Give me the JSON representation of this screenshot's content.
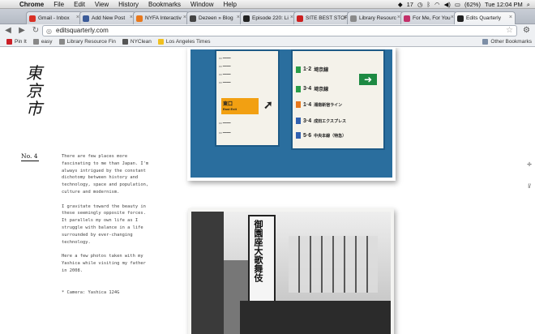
{
  "menubar": {
    "app": "Chrome",
    "items": [
      "File",
      "Edit",
      "View",
      "History",
      "Bookmarks",
      "Window",
      "Help"
    ],
    "status": {
      "notifications": "17",
      "battery": "(62%)",
      "clock": "Tue 12:04 PM"
    }
  },
  "tabs": [
    {
      "label": "Gmail - Inbox",
      "color": "#d93025"
    },
    {
      "label": "Add New Post",
      "color": "#3b5b99"
    },
    {
      "label": "NYFA Interactiv",
      "color": "#e8781c"
    },
    {
      "label": "Dezeen » Blog",
      "color": "#444444"
    },
    {
      "label": "Episode 220: Li",
      "color": "#222222"
    },
    {
      "label": "SITE BEST STOR",
      "color": "#cc1f1f"
    },
    {
      "label": "Library Resourc",
      "color": "#8a8a8a"
    },
    {
      "label": "For Me, For You",
      "color": "#c3306a"
    },
    {
      "label": "Edits Quarterly",
      "color": "#222222"
    }
  ],
  "toolbar": {
    "url": "editsquarterly.com"
  },
  "bookmarks": [
    {
      "label": "Pin It",
      "color": "#cb2027"
    },
    {
      "label": "easy",
      "color": "#888888"
    },
    {
      "label": "Library Resource Fin",
      "color": "#888888"
    },
    {
      "label": "NYClean",
      "color": "#555555"
    },
    {
      "label": "Los Angeles Times",
      "color": "#f0c020"
    }
  ],
  "bookmarks_other": "Other Bookmarks",
  "page": {
    "title_kanji": "東京市",
    "issue": "No. 4",
    "paragraphs": [
      "There are few places more fascinating to me than Japan. I'm always intrigued by the constant dichotomy between history and technology, space and population, culture and modernism.",
      "I gravitate toward the beauty in these seemingly opposite forces. It parallels my own life as I struggle with balance in a life surrounded by ever-changing technology.",
      "Here a few photos taken with my Yashica while visiting my father in 2008.",
      "* Camera: Yashica 124G"
    ]
  },
  "photo1": {
    "left_sign": {
      "exit": "東口",
      "exit_en": "East Exit"
    },
    "right_sign": {
      "lines": [
        {
          "num": "1·2",
          "name": "埼京線",
          "color": "#2a9d4a"
        },
        {
          "num": "3·4",
          "name": "埼京線",
          "color": "#2a9d4a"
        },
        {
          "num": "1·4",
          "name": "湘南新宿ライン",
          "color": "#e8781c"
        },
        {
          "num": "3·4",
          "name": "成田エクスプレス",
          "color": "#3060b0"
        },
        {
          "num": "5·6",
          "name": "中央本線（特急）",
          "color": "#3060b0"
        }
      ]
    }
  },
  "photo2": {
    "banner": "御園座大歌舞伎"
  }
}
